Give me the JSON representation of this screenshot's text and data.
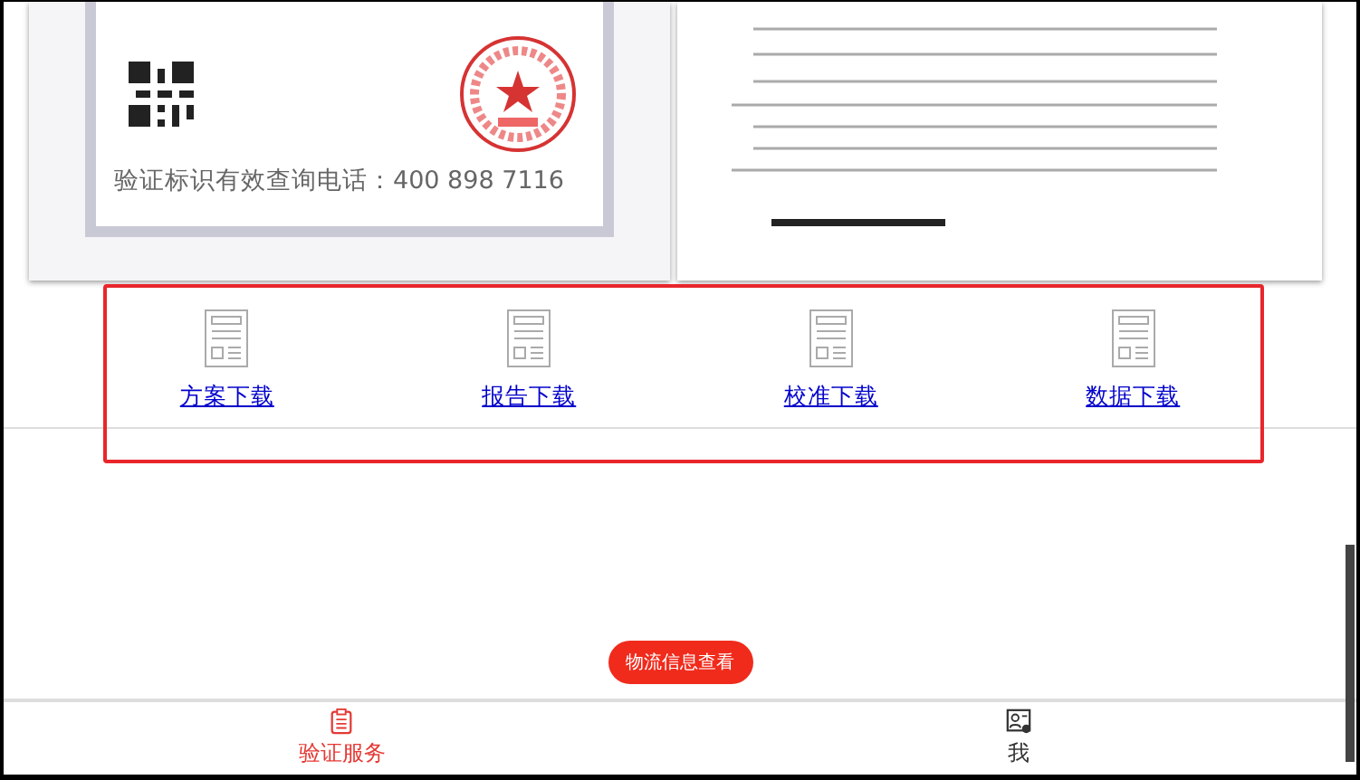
{
  "certificate": {
    "phone_line": "验证标识有效查询电话：400 898 7116"
  },
  "downloads": [
    {
      "label": "方案下载"
    },
    {
      "label": "报告下载"
    },
    {
      "label": "校准下载"
    },
    {
      "label": "数据下载"
    }
  ],
  "logistics_button": "物流信息查看",
  "tab_bar": [
    {
      "label": "验证服务",
      "selected": true,
      "kind": "clipboard"
    },
    {
      "label": "我",
      "selected": false,
      "kind": "profile"
    }
  ]
}
